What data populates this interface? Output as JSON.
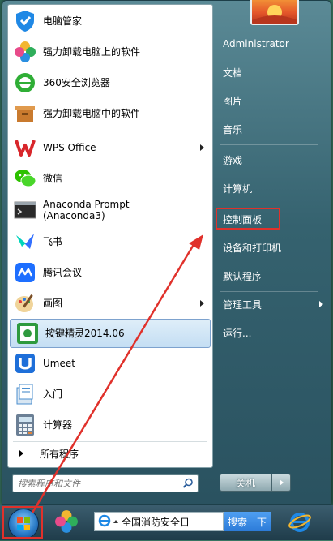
{
  "left_programs": [
    {
      "label": "电脑管家",
      "icon": "tencent-pc-manager-icon",
      "color": "#1f88e5"
    },
    {
      "label": "强力卸载电脑上的软件",
      "icon": "uninstall-flower-icon",
      "color": "#e84b8a"
    },
    {
      "label": "360安全浏览器",
      "icon": "360-browser-icon",
      "color": "#2fae36"
    },
    {
      "label": "强力卸载电脑中的软件",
      "icon": "uninstall-box-icon",
      "color": "#c97a2e"
    },
    {
      "label": "WPS Office",
      "icon": "wps-icon",
      "color": "#d8262b",
      "has_submenu": true
    },
    {
      "label": "微信",
      "icon": "wechat-icon",
      "color": "#2dc100"
    },
    {
      "label": "Anaconda Prompt",
      "label2": "(Anaconda3)",
      "icon": "terminal-icon",
      "color": "#2a2a2a"
    },
    {
      "label": "飞书",
      "icon": "feishu-icon",
      "color": "#3370ff"
    },
    {
      "label": "腾讯会议",
      "icon": "tencent-meeting-icon",
      "color": "#1e6fff"
    },
    {
      "label": "画图",
      "icon": "paint-icon",
      "color": "#e0a43a",
      "has_submenu": true
    },
    {
      "label": "按键精灵2014.06",
      "icon": "key-wizard-icon",
      "color": "#2e9a3e",
      "selected": true
    },
    {
      "label": "Umeet",
      "icon": "umeet-icon",
      "color": "#1e6fd9"
    },
    {
      "label": "入门",
      "icon": "getting-started-icon",
      "color": "#4b8fcf"
    },
    {
      "label": "计算器",
      "icon": "calculator-icon",
      "color": "#6b7f95"
    }
  ],
  "all_programs": "所有程序",
  "search": {
    "placeholder": "搜索程序和文件"
  },
  "right_items": [
    {
      "label": "Administrator"
    },
    {
      "label": "文档"
    },
    {
      "label": "图片"
    },
    {
      "label": "音乐"
    },
    {
      "label": "游戏"
    },
    {
      "label": "计算机"
    },
    {
      "label": "控制面板",
      "highlighted": true
    },
    {
      "label": "设备和打印机"
    },
    {
      "label": "默认程序"
    },
    {
      "label": "管理工具",
      "has_submenu": true
    },
    {
      "label": "运行..."
    }
  ],
  "shutdown": {
    "label": "关机"
  },
  "taskbar": {
    "news_text": "全国消防安全日",
    "search_button": "搜索一下"
  },
  "accent": {
    "annotation_red": "#e0312b",
    "selection_blue": "#c4def3"
  }
}
